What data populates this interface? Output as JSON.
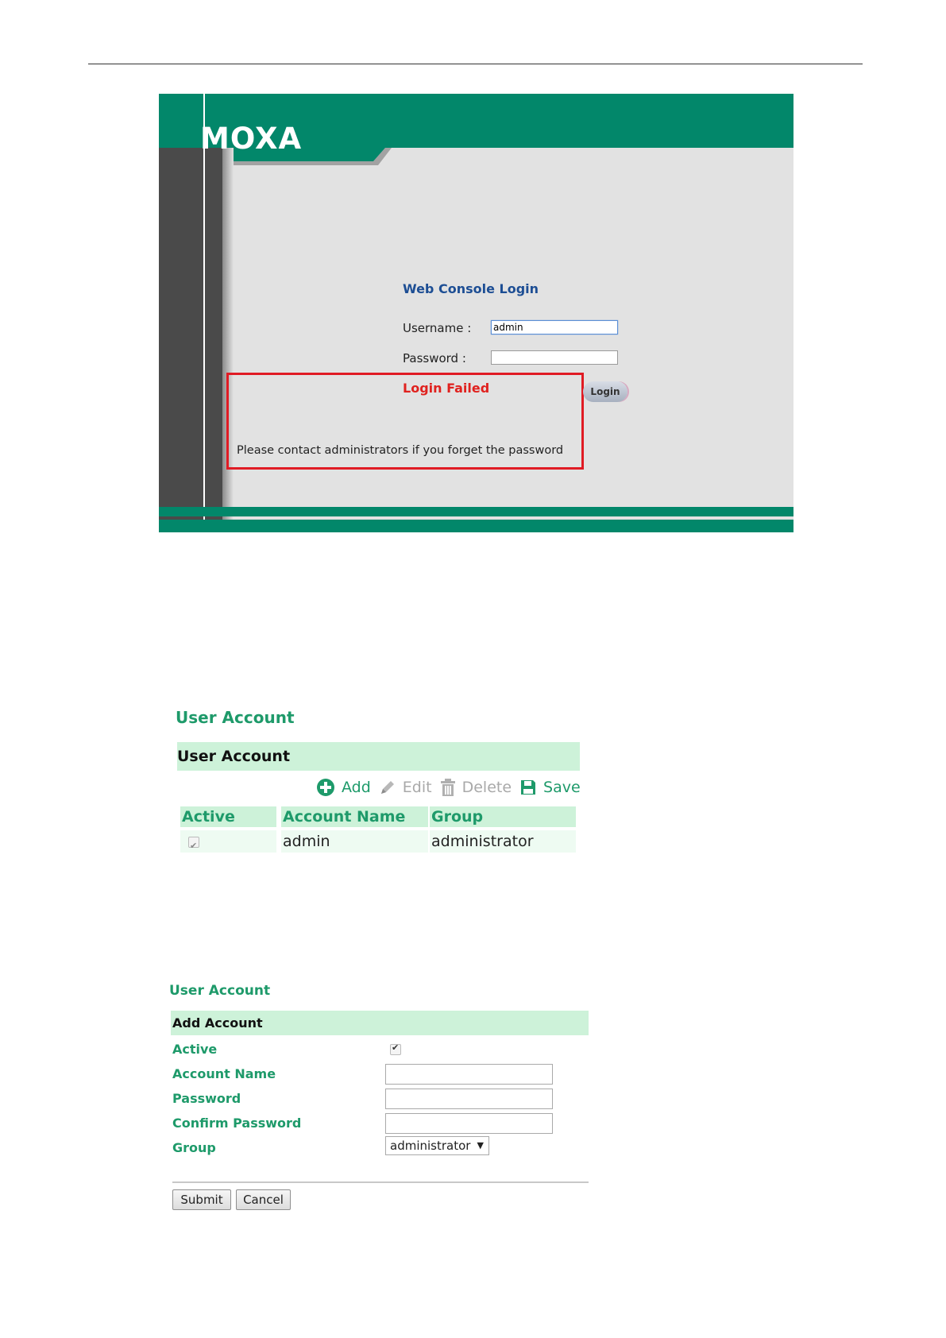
{
  "login": {
    "brand": "MOXA",
    "title": "Web Console Login",
    "username_label": "Username :",
    "username_value": "admin",
    "password_label": "Password :",
    "error_title": "Login Failed",
    "error_message": "Please contact administrators if you forget the password",
    "login_button": "Login",
    "colors": {
      "brand_green": "#02876a",
      "title_blue": "#1d4e94",
      "error_red": "#e0221f"
    }
  },
  "user_list": {
    "heading": "User Account",
    "panel_title": "User Account",
    "toolbar": {
      "add": "Add",
      "edit": "Edit",
      "delete": "Delete",
      "save": "Save",
      "icons": [
        "plus-circle-icon",
        "pencil-icon",
        "trash-icon",
        "floppy-disk-icon"
      ]
    },
    "columns": [
      "Active",
      "Account Name",
      "Group"
    ],
    "rows": [
      {
        "active": true,
        "account_name": "admin",
        "group": "administrator"
      }
    ]
  },
  "add_account": {
    "heading": "User Account",
    "panel_title": "Add Account",
    "labels": {
      "active": "Active",
      "account_name": "Account Name",
      "password": "Password",
      "confirm_password": "Confirm Password",
      "group": "Group"
    },
    "active_checked": true,
    "group_value": "administrator",
    "submit": "Submit",
    "cancel": "Cancel"
  }
}
